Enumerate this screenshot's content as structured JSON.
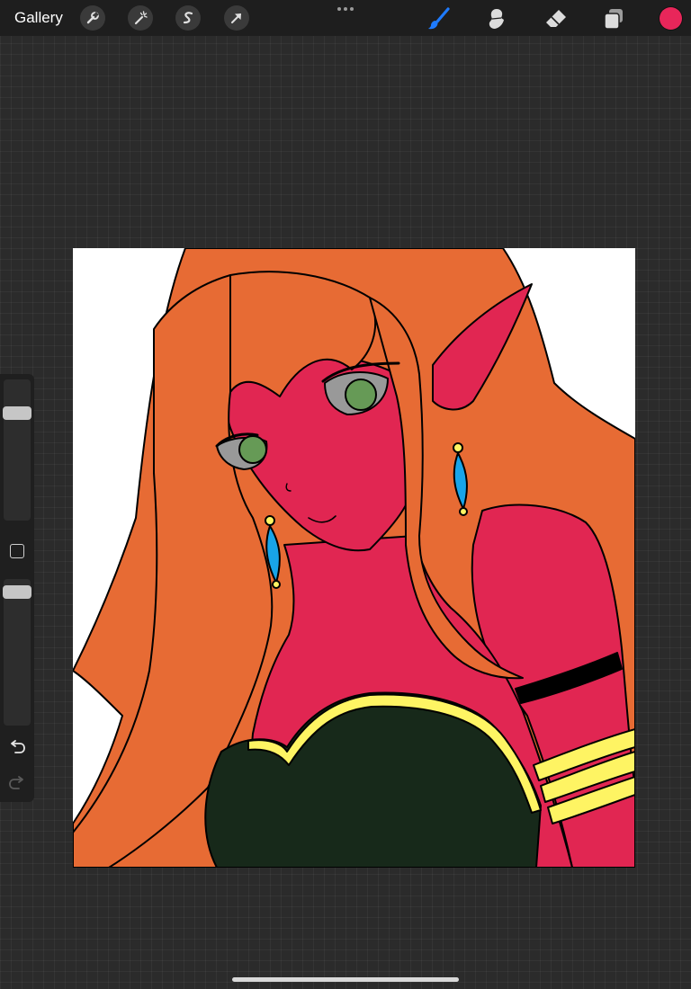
{
  "topbar": {
    "gallery_label": "Gallery",
    "left_tools": [
      "wrench-icon",
      "magic-wand-icon",
      "selection-s-icon",
      "transform-arrow-icon"
    ],
    "right_tools": [
      "brush-icon",
      "smudge-icon",
      "eraser-icon",
      "layers-icon"
    ],
    "active_tool": "brush-icon",
    "current_color": "#e8265a",
    "accent_color": "#1e7bff"
  },
  "sidebar": {
    "size_slider_level": 0.21,
    "opacity_slider_level": 0.05
  },
  "canvas": {
    "background": "#ffffff",
    "palette": {
      "hair": "#e76b34",
      "skin": "#e12652",
      "top": "#17291a",
      "gold": "#fef463",
      "earring": "#18a4e9",
      "eye": "#669a56",
      "sclera": "#999999",
      "line": "#000000"
    }
  }
}
